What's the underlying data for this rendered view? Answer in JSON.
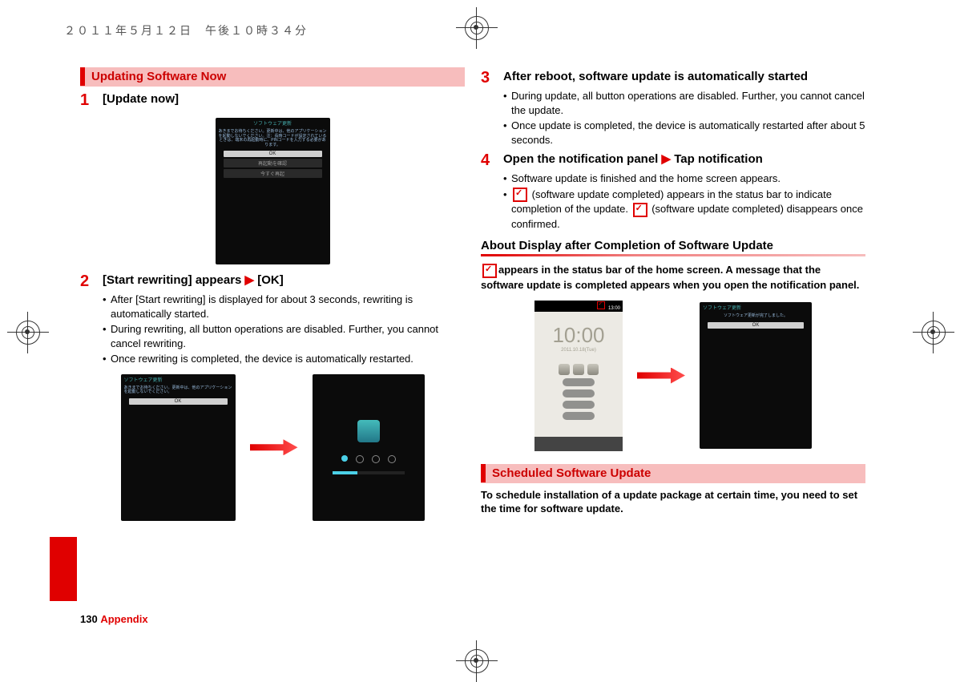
{
  "header_timestamp": "２０１１年５月１２日　午後１０時３４分",
  "left": {
    "section_title": "Updating Software Now",
    "step1": {
      "num": "1",
      "title": "[Update now]"
    },
    "step2": {
      "num": "2",
      "title_a": "[Start rewriting] appears ",
      "title_b": " [OK]",
      "bullets": [
        "After [Start rewriting] is displayed for about 3 seconds, rewriting is automatically started.",
        "During rewriting, all button operations are disabled. Further, you cannot cancel rewriting.",
        "Once rewriting is completed, the device is automatically restarted."
      ]
    },
    "phone1": {
      "title": "ソフトウェア更新",
      "body": "あきまでお待ちください。更新中は、他のアプリケーションを起動しないでください。注：長時コードが設定されているときは、端末の再起動時に、PINコードを入力する必要があります。",
      "btn1": "OK",
      "btn2": "再起動を確認",
      "btn3": "今すぐ再起"
    },
    "phone2": {
      "title": "ソフトウェア更新",
      "body": "あきまでお待ちください。更新中は、他のアプリケーションを起動しないでください。",
      "btn": "OK"
    }
  },
  "right": {
    "step3": {
      "num": "3",
      "title": "After reboot, software update is automatically started",
      "bullets": [
        "During update, all button operations are disabled. Further, you cannot cancel the update.",
        "Once update is completed, the device is automatically restarted after about 5 seconds."
      ]
    },
    "step4": {
      "num": "4",
      "title_a": "Open the notification panel ",
      "title_b": " Tap notification",
      "bullet1": "Software update is finished and the home screen appears.",
      "bullet2_a": " (software update completed) appears in the status bar to indicate completion of the update. ",
      "bullet2_b": " (software update completed) disappears once confirmed."
    },
    "subheading": "About Display after Completion of Software Update",
    "bold_para": "appears in the status bar of the home screen. A message that the software update is completed appears when you open the notification panel.",
    "home_phone": {
      "status_time": "13:00",
      "clock": "10:00",
      "date": "2011.10.18(Tue)"
    },
    "phone5": {
      "title": "ソフトウェア更新",
      "msg": "ソフトウェア更新が完了しました。",
      "btn": "OK"
    },
    "section2_title": "Scheduled Software Update",
    "section2_body": "To schedule installation of a update package at certain time, you need to set the time for software update."
  },
  "footer": {
    "page": "130",
    "section": "Appendix"
  }
}
